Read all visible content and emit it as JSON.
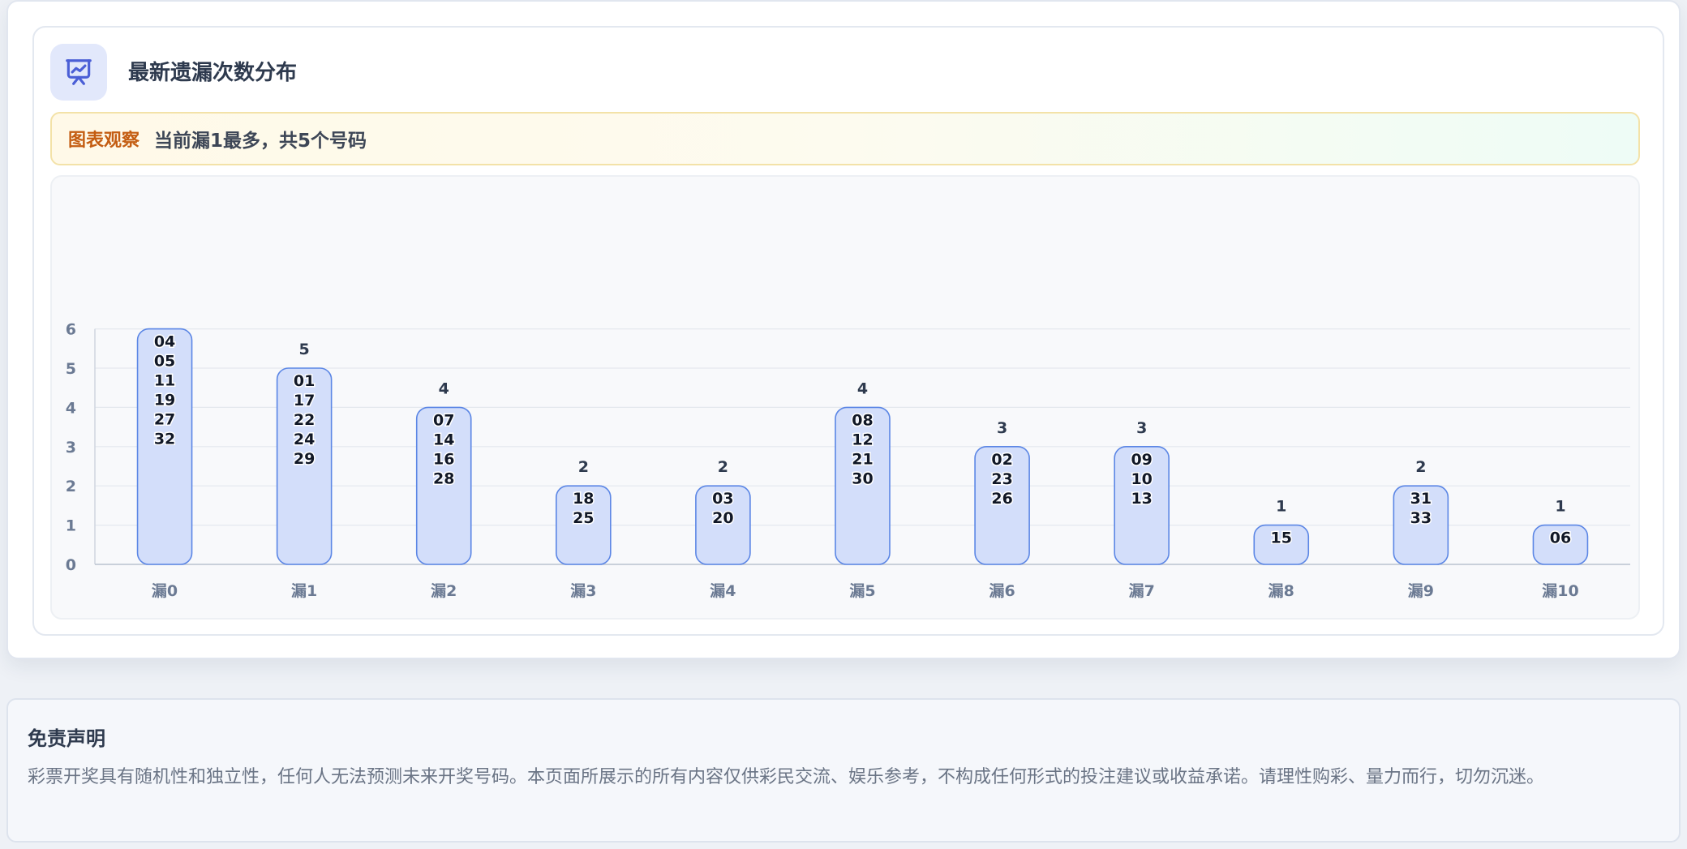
{
  "card": {
    "title": "最新遗漏次数分布",
    "icon": "presentation-chart-icon"
  },
  "insight": {
    "tag": "图表观察",
    "text": "当前漏1最多，共5个号码"
  },
  "chart_data": {
    "type": "bar",
    "categories": [
      "漏0",
      "漏1",
      "漏2",
      "漏3",
      "漏4",
      "漏5",
      "漏6",
      "漏7",
      "漏8",
      "漏9",
      "漏10"
    ],
    "values": [
      6,
      5,
      4,
      2,
      2,
      4,
      3,
      3,
      1,
      2,
      1
    ],
    "numbers": [
      [
        "04",
        "05",
        "11",
        "19",
        "27",
        "32"
      ],
      [
        "01",
        "17",
        "22",
        "24",
        "29"
      ],
      [
        "07",
        "14",
        "16",
        "28"
      ],
      [
        "18",
        "25"
      ],
      [
        "03",
        "20"
      ],
      [
        "08",
        "12",
        "21",
        "30"
      ],
      [
        "02",
        "23",
        "26"
      ],
      [
        "09",
        "10",
        "13"
      ],
      [
        "15"
      ],
      [
        "31",
        "33"
      ],
      [
        "06"
      ]
    ],
    "value_labels": [
      "",
      "5",
      "4",
      "2",
      "2",
      "4",
      "3",
      "3",
      "1",
      "2",
      "1"
    ],
    "yticks": [
      "0",
      "1",
      "2",
      "3",
      "4",
      "5",
      "6"
    ],
    "ylim": [
      0,
      6
    ],
    "grid": true,
    "colors": {
      "bar_fill": "#d3defa",
      "bar_stroke": "#5b86e5",
      "axis_text": "#6b7a93",
      "label_text": "#2e3a4e"
    }
  },
  "disclaimer": {
    "title": "免责声明",
    "text": "彩票开奖具有随机性和独立性，任何人无法预测未来开奖号码。本页面所展示的所有内容仅供彩民交流、娱乐参考，不构成任何形式的投注建议或收益承诺。请理性购彩、量力而行，切勿沉迷。"
  }
}
